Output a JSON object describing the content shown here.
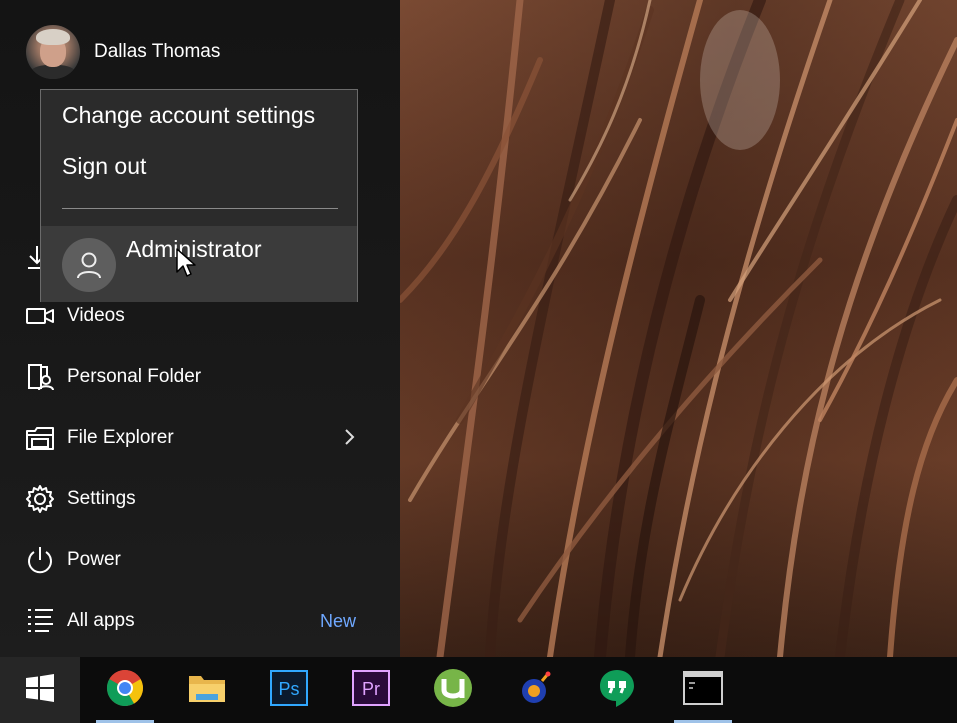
{
  "user": {
    "name": "Dallas Thomas"
  },
  "account_flyout": {
    "change_settings_label": "Change account settings",
    "sign_out_label": "Sign out",
    "other_account_name": "Administrator"
  },
  "nav_items": [
    {
      "label": "Videos",
      "icon": "video-icon"
    },
    {
      "label": "Personal Folder",
      "icon": "personal-folder-icon"
    },
    {
      "label": "File Explorer",
      "icon": "file-explorer-icon",
      "has_submenu": true
    },
    {
      "label": "Settings",
      "icon": "gear-icon"
    },
    {
      "label": "Power",
      "icon": "power-icon"
    },
    {
      "label": "All apps",
      "icon": "all-apps-icon",
      "badge": "New"
    }
  ],
  "taskbar": {
    "items": [
      {
        "name": "start",
        "icon": "windows-icon"
      },
      {
        "name": "chrome",
        "icon": "chrome-icon",
        "running": true
      },
      {
        "name": "file-explorer",
        "icon": "folder-icon"
      },
      {
        "name": "photoshop",
        "icon": "photoshop-icon",
        "label": "Ps"
      },
      {
        "name": "premiere",
        "icon": "premiere-icon",
        "label": "Pr"
      },
      {
        "name": "utorrent",
        "icon": "utorrent-icon"
      },
      {
        "name": "app-bomb",
        "icon": "bomb-icon"
      },
      {
        "name": "hangouts",
        "icon": "hangouts-icon"
      },
      {
        "name": "command-prompt",
        "icon": "terminal-icon",
        "running": true
      }
    ]
  },
  "colors": {
    "accent_blue": "#6fa8ff",
    "photoshop": "#31a8ff",
    "premiere": "#e0a3ff",
    "utorrent": "#77b548",
    "hangouts": "#0f9d58"
  }
}
